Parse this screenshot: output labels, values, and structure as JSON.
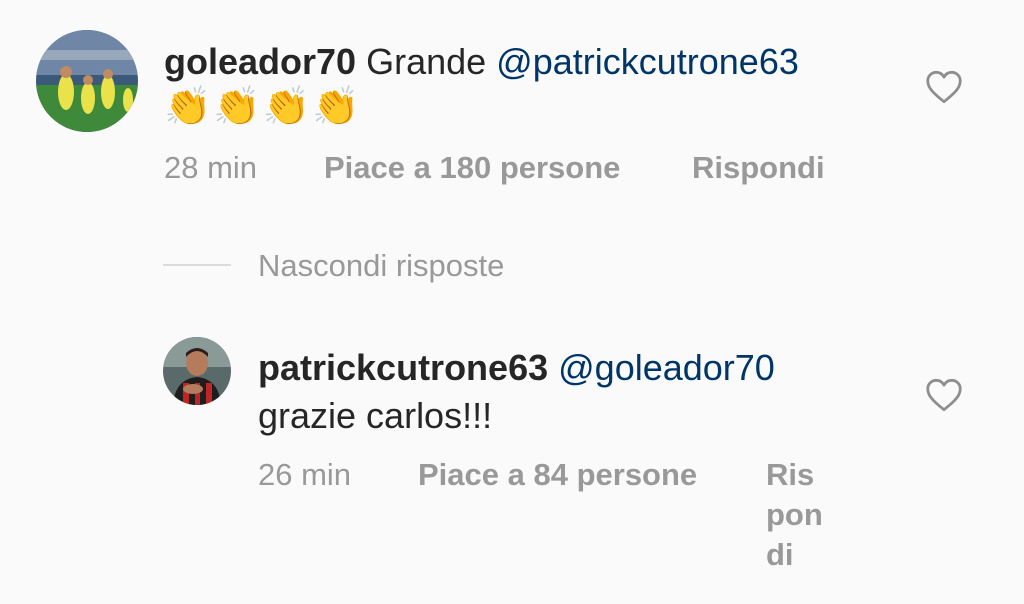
{
  "comment": {
    "username": "goleador70",
    "text": "Grande",
    "mention": "@patrickcutrone63",
    "emojis": "👏👏👏👏",
    "time": "28 min",
    "likes": "Piace a 180 persone",
    "reply": "Rispondi"
  },
  "thread": {
    "toggle_label": "Nascondi risposte"
  },
  "reply": {
    "username": "patrickcutrone63",
    "mention": "@goleador70",
    "text": "grazie carlos!!!",
    "time": "26 min",
    "likes": "Piace a 84 persone",
    "reply": "Rispondi"
  },
  "colors": {
    "background": "#fafafa",
    "mention": "#003569",
    "meta": "#999999",
    "heart_outline": "#8e8e8e"
  }
}
